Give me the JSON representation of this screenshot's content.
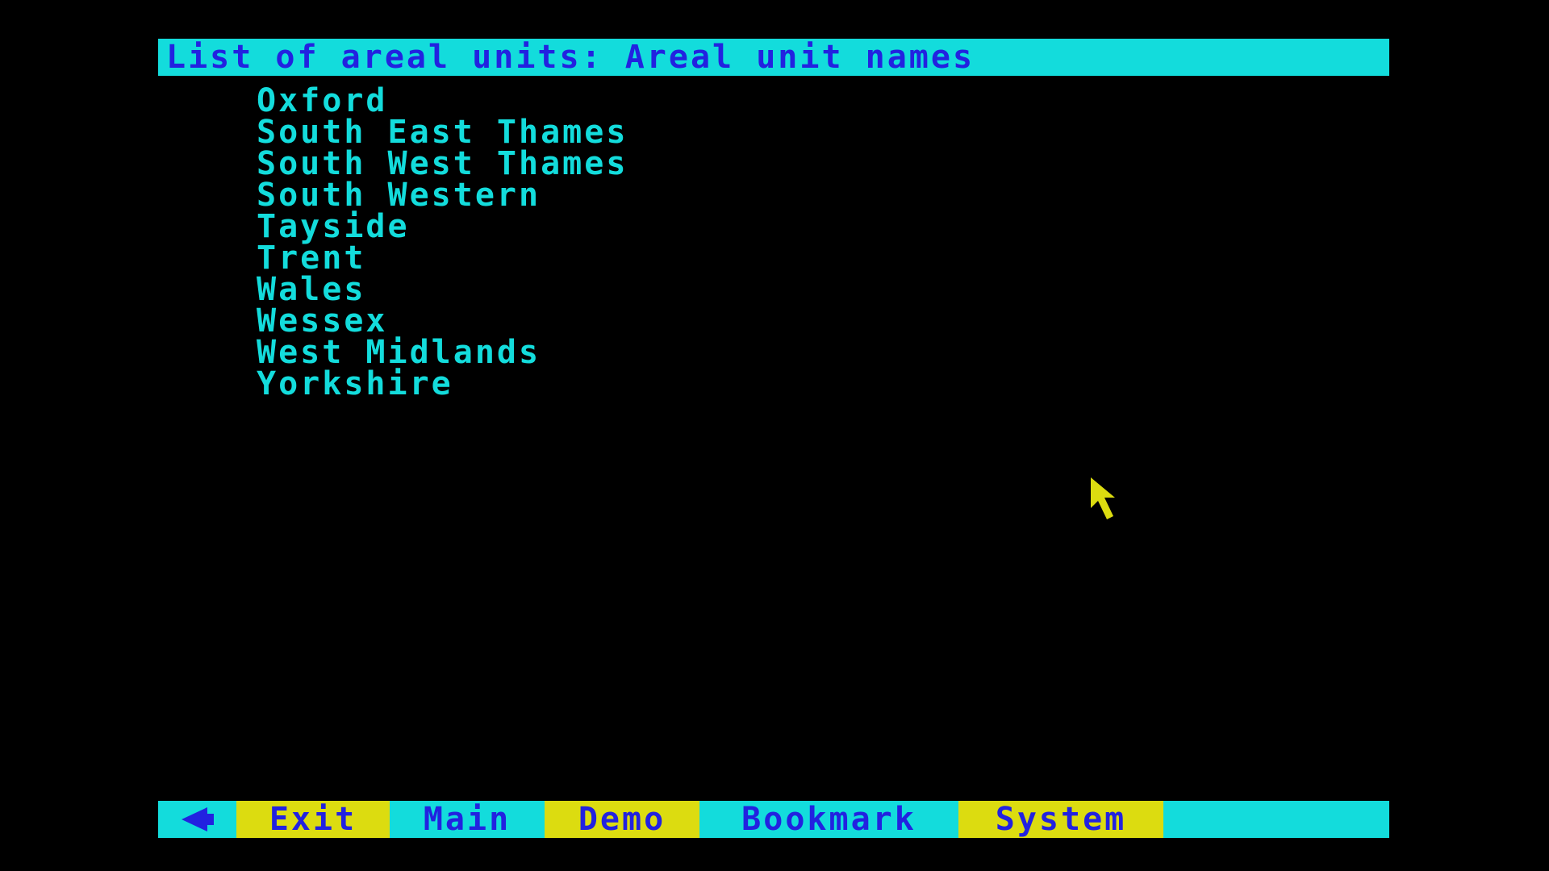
{
  "title": {
    "text": "List of areal units: Areal unit names"
  },
  "areal_units": [
    "Oxford",
    "South East Thames",
    "South West Thames",
    "South Western",
    "Tayside",
    "Trent",
    "Wales",
    "Wessex",
    "West Midlands",
    "Yorkshire"
  ],
  "menu": {
    "back_icon": "left-arrow-icon",
    "exit_label": "Exit",
    "main_label": "Main",
    "demo_label": "Demo",
    "bookmark_label": "Bookmark",
    "system_label": "System"
  },
  "cursor_icon": "pointer-arrow-icon",
  "colors": {
    "background": "#000000",
    "cyan": "#13dcdc",
    "blue_text": "#2222e0",
    "yellow": "#dcdc10"
  }
}
